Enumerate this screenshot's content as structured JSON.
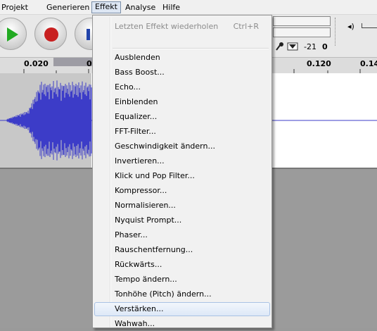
{
  "menubar": {
    "items": [
      "Projekt",
      "Generieren",
      "Effekt",
      "Analyse",
      "Hilfe"
    ],
    "active": "Effekt"
  },
  "meters": {
    "value_a": "-21",
    "value_b": "0",
    "speaker_icon": "◂)"
  },
  "ruler": {
    "labels": [
      "0.020",
      "0",
      "0.120",
      "0.14"
    ]
  },
  "effect_menu": {
    "repeat_last": "Letzten Effekt wiederholen",
    "repeat_shortcut": "Ctrl+R",
    "items": [
      "Ausblenden",
      "Bass Boost...",
      "Echo...",
      "Einblenden",
      "Equalizer...",
      "FFT-Filter...",
      "Geschwindigkeit ändern...",
      "Invertieren...",
      "Klick und Pop Filter...",
      "Kompressor...",
      "Normalisieren...",
      "Nyquist Prompt...",
      "Phaser...",
      "Rauschentfernung...",
      "Rückwärts...",
      "Tempo ändern...",
      "Tonhöhe (Pitch) ändern...",
      "Verstärken...",
      "Wahwah..."
    ],
    "highlighted": "Verstärken..."
  },
  "colors": {
    "waveform": "#3c3cc8",
    "menu_highlight": "#dde8f7",
    "play": "#22aa22",
    "record": "#c82020",
    "pause": "#2244aa"
  }
}
